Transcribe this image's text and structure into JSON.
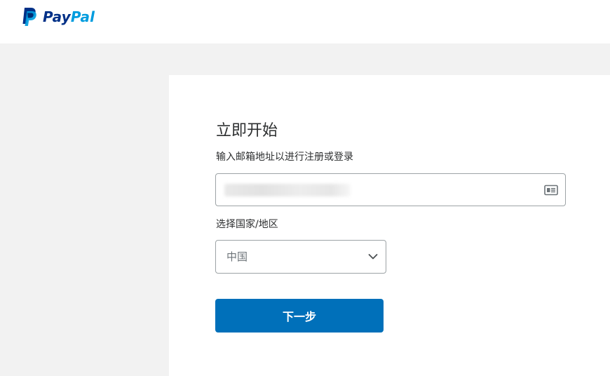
{
  "header": {
    "logo_text_pay": "Pay",
    "logo_text_pal": "Pal"
  },
  "form": {
    "title": "立即开始",
    "subtitle": "输入邮箱地址以进行注册或登录",
    "email": {
      "value_state": "redacted (blurred)"
    },
    "country": {
      "label": "选择国家/地区",
      "selected": "中国"
    },
    "next_label": "下一步"
  },
  "colors": {
    "brand_dark": "#003087",
    "brand_light": "#009cde",
    "button": "#0070ba",
    "backdrop": "#f2f2f2"
  },
  "icons": {
    "email_field": "contact-card-icon",
    "country_select": "chevron-down-icon"
  }
}
